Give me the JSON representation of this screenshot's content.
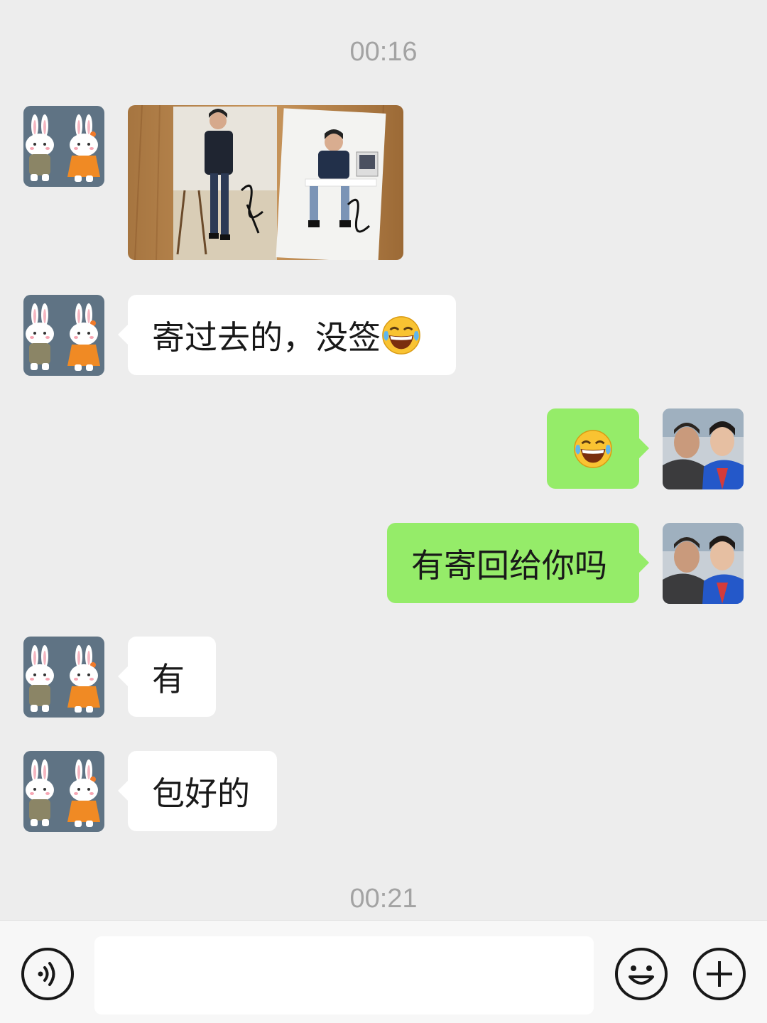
{
  "chat": {
    "timestamps": [
      "00:16",
      "00:21"
    ],
    "messages": [
      {
        "from": "contact",
        "type": "image",
        "image": "two signed photos of a man in denim"
      },
      {
        "from": "contact",
        "type": "text",
        "text": "寄过去的，没签",
        "emoji": "laughing-tears-emoji"
      },
      {
        "from": "me",
        "type": "emoji",
        "emoji": "laughing-tears-emoji"
      },
      {
        "from": "me",
        "type": "text",
        "text": "有寄回给你吗"
      },
      {
        "from": "contact",
        "type": "text",
        "text": "有"
      },
      {
        "from": "contact",
        "type": "text",
        "text": "包好的"
      }
    ]
  },
  "input_bar": {
    "placeholder": "",
    "voice_icon": "voice-icon",
    "emoji_icon": "smiley-icon",
    "more_icon": "plus-icon"
  },
  "colors": {
    "background": "#ededed",
    "incoming_bubble": "#ffffff",
    "outgoing_bubble": "#95ec69",
    "timestamp": "#a3a3a3"
  }
}
